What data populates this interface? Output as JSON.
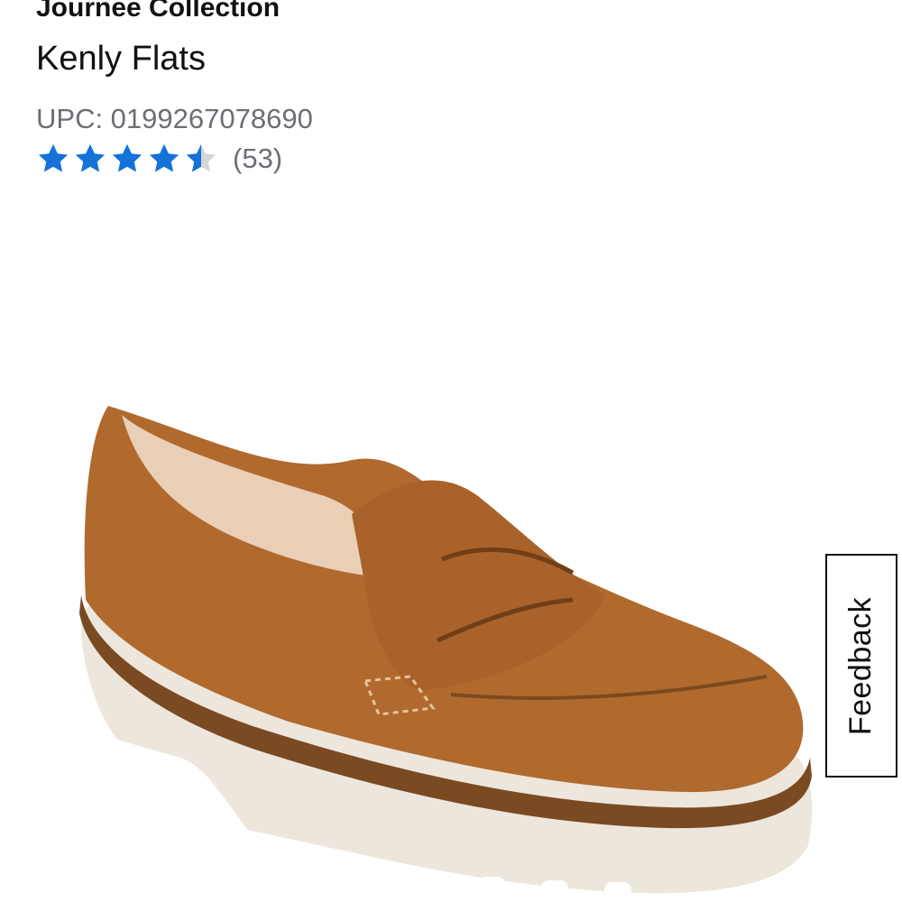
{
  "product": {
    "brand": "Journee Collection",
    "name": "Kenly Flats",
    "upc": "UPC: 0199267078690",
    "rating": {
      "value": 4.5,
      "max": 5,
      "count_label": "(53)"
    },
    "image_icon": "loafer-shoe-image"
  },
  "feedback": {
    "label": "Feedback"
  },
  "colors": {
    "star": "#1472d9",
    "star_empty": "#d6d6d6",
    "meta_text": "#6b6f75",
    "shoe_suede": "#b06a2e",
    "sole": "#ece6dc"
  }
}
